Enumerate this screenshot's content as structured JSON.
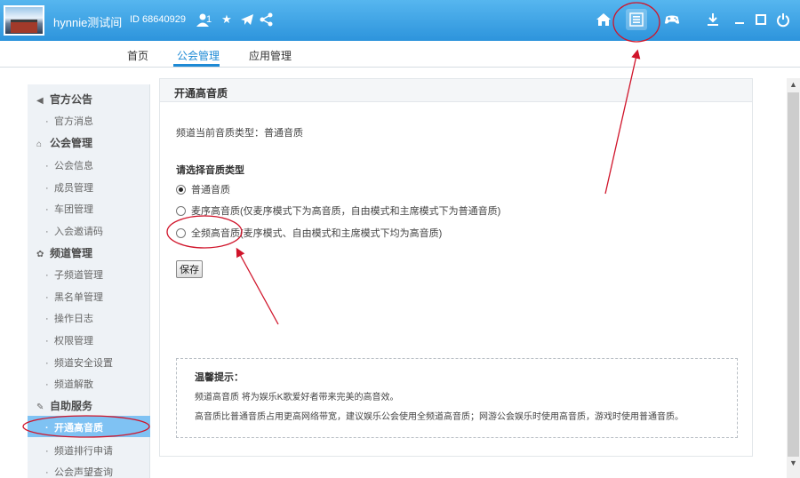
{
  "titlebar": {
    "username": "hynnie测试间",
    "id_text": "ID 68640929",
    "member_count": "1",
    "icons": [
      "user-icon",
      "star-icon",
      "plane-icon",
      "share-icon",
      "home-icon",
      "list-icon",
      "gamepad-icon",
      "download-icon",
      "minimize-icon",
      "maximize-icon",
      "power-icon"
    ]
  },
  "nav": {
    "tabs": [
      "首页",
      "公会管理",
      "应用管理"
    ],
    "active": "公会管理"
  },
  "sidebar": {
    "sections": [
      {
        "title": "官方公告",
        "icon": "speaker-icon",
        "items": [
          "官方消息"
        ]
      },
      {
        "title": "公会管理",
        "icon": "house-icon",
        "items": [
          "公会信息",
          "成员管理",
          "车团管理",
          "入会邀请码"
        ]
      },
      {
        "title": "频道管理",
        "icon": "settings-icon",
        "items": [
          "子频道管理",
          "黑名单管理",
          "操作日志",
          "权限管理",
          "频道安全设置",
          "频道解散"
        ]
      },
      {
        "title": "自助服务",
        "icon": "wrench-icon",
        "items": [
          "开通高音质",
          "频道排行申请",
          "公会声望查询"
        ]
      }
    ],
    "active_item": "开通高音质"
  },
  "content": {
    "title": "开通高音质",
    "current_quality": "频道当前音质类型：普通音质",
    "choose_label": "请选择音质类型",
    "options": [
      {
        "label": "普通音质",
        "selected": true
      },
      {
        "label": "麦序高音质(仅麦序模式下为高音质，自由模式和主席模式下为普通音质)",
        "selected": false
      },
      {
        "label": "全频高音质(麦序模式、自由模式和主席模式下均为高音质)",
        "selected": false
      }
    ],
    "save_label": "保存",
    "tips": {
      "title": "温馨提示：",
      "lines": [
        "频道高音质    将为娱乐K歌爱好者带来完美的高音效。",
        "高音质比普通音质占用更高网络带宽，建议娱乐公会使用全频道高音质；网游公会娱乐时使用高音质，游戏时使用普通音质。"
      ]
    }
  },
  "colors": {
    "titlebar": "#2d94dc",
    "accent": "#1e8ad5",
    "sidebar_active": "#7fc2f3",
    "annotation": "#d0142a"
  }
}
